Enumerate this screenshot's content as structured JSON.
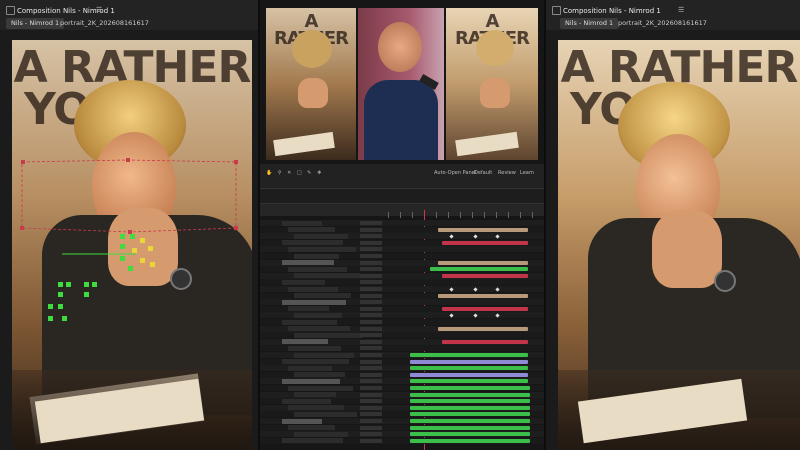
{
  "left_panel": {
    "title": "Composition Nils - Nimrod 1",
    "menu_icon": "hamburger-menu-icon",
    "breadcrumb_active": "Nils - Nimrod 1",
    "breadcrumb_next": "portrait_2K_202608161617",
    "poster_line1": "A RATHER",
    "poster_line2": "YOU"
  },
  "right_panel": {
    "title": "Composition Nils - Nimrod 1",
    "menu_icon": "hamburger-menu-icon",
    "breadcrumb_active": "Nils - Nimrod 1",
    "breadcrumb_next": "portrait_2K_202608161617",
    "poster_line1": "A RATHER",
    "poster_line2": "YOU"
  },
  "center": {
    "thumb1_poster": "A RATHER",
    "thumb3_poster": "A RATHER",
    "toolbar_label": "Auto-Open Panel",
    "toolbar_items": [
      "Default",
      "Review",
      "Learn"
    ]
  },
  "colors": {
    "accent_red": "#c93a4a",
    "handle_green": "#3fdc3f",
    "bar_green": "#3bbf4a",
    "bar_purple": "#8e8ad6",
    "bar_red": "#c2344a",
    "bar_tan": "#b79a7a"
  }
}
